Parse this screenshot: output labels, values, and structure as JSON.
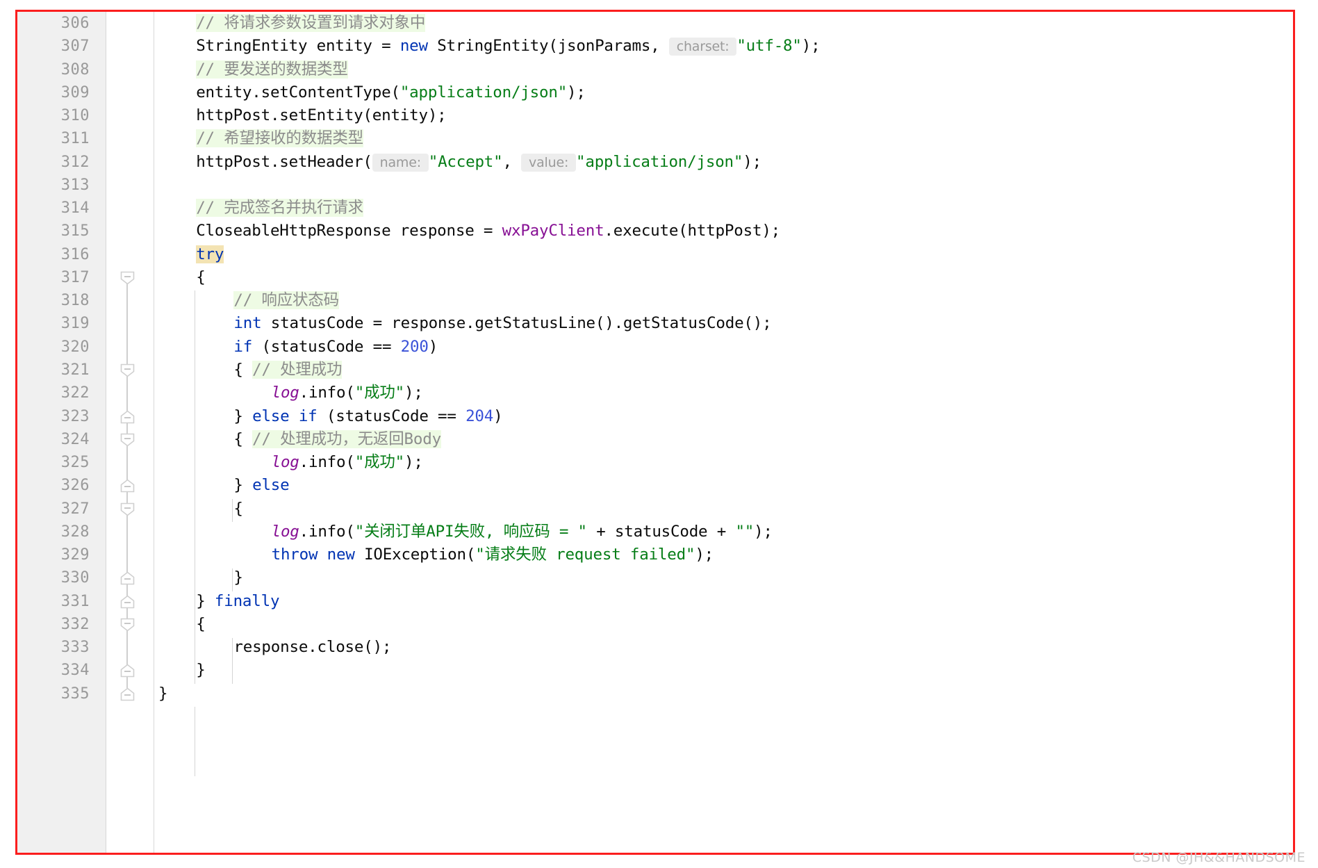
{
  "editor": {
    "language": "Java",
    "theme": "IntelliJ Light",
    "first_line": 306,
    "last_line": 335,
    "colors": {
      "keyword": "#0033b3",
      "number": "#3a52d8",
      "string": "#067d17",
      "field": "#871094",
      "comment_text": "#8c8c8c",
      "comment_background": "#eefbe4",
      "parameter_hint_background": "#ededed",
      "caret_highlight": "#f3e3b3",
      "gutter_background": "#f0f0f0",
      "line_number": "#999999",
      "annotation_border": "#fb1e1e"
    }
  },
  "watermark": {
    "text": "CSDN @JH&&HANDSOME"
  },
  "line_numbers": [
    "306",
    "307",
    "308",
    "309",
    "310",
    "311",
    "312",
    "313",
    "314",
    "315",
    "316",
    "317",
    "318",
    "319",
    "320",
    "321",
    "322",
    "323",
    "324",
    "325",
    "326",
    "327",
    "328",
    "329",
    "330",
    "331",
    "332",
    "333",
    "334",
    "335"
  ],
  "code_lines": [
    {
      "number": "306",
      "text": "    // 将请求参数设置到请求对象中",
      "fold": "none"
    },
    {
      "number": "307",
      "text": "    StringEntity entity = new StringEntity(jsonParams,  charset: \"utf-8\");",
      "fold": "none"
    },
    {
      "number": "308",
      "text": "    // 要发送的数据类型",
      "fold": "none"
    },
    {
      "number": "309",
      "text": "    entity.setContentType(\"application/json\");",
      "fold": "none"
    },
    {
      "number": "310",
      "text": "    httpPost.setEntity(entity);",
      "fold": "none"
    },
    {
      "number": "311",
      "text": "    // 希望接收的数据类型",
      "fold": "none"
    },
    {
      "number": "312",
      "text": "    httpPost.setHeader( name: \"Accept\",  value: \"application/json\");",
      "fold": "none"
    },
    {
      "number": "313",
      "text": "",
      "fold": "none"
    },
    {
      "number": "314",
      "text": "    // 完成签名并执行请求",
      "fold": "none"
    },
    {
      "number": "315",
      "text": "    CloseableHttpResponse response = wxPayClient.execute(httpPost);",
      "fold": "none"
    },
    {
      "number": "316",
      "text": "    try",
      "fold": "none"
    },
    {
      "number": "317",
      "text": "    {",
      "fold": "expanded-down"
    },
    {
      "number": "318",
      "text": "        // 响应状态码",
      "fold": "none"
    },
    {
      "number": "319",
      "text": "        int statusCode = response.getStatusLine().getStatusCode();",
      "fold": "none"
    },
    {
      "number": "320",
      "text": "        if (statusCode == 200)",
      "fold": "none"
    },
    {
      "number": "321",
      "text": "        { // 处理成功",
      "fold": "expanded-down"
    },
    {
      "number": "322",
      "text": "            log.info(\"成功\");",
      "fold": "none"
    },
    {
      "number": "323",
      "text": "        } else if (statusCode == 204)",
      "fold": "expanded-up"
    },
    {
      "number": "324",
      "text": "        { // 处理成功，无返回Body",
      "fold": "expanded-down"
    },
    {
      "number": "325",
      "text": "            log.info(\"成功\");",
      "fold": "none"
    },
    {
      "number": "326",
      "text": "        } else",
      "fold": "expanded-up"
    },
    {
      "number": "327",
      "text": "        {",
      "fold": "expanded-down"
    },
    {
      "number": "328",
      "text": "            log.info(\"关闭订单API失败, 响应码 = \" + statusCode + \"\");",
      "fold": "none"
    },
    {
      "number": "329",
      "text": "            throw new IOException(\"请求失败 request failed\");",
      "fold": "none"
    },
    {
      "number": "330",
      "text": "        }",
      "fold": "expanded-up"
    },
    {
      "number": "331",
      "text": "    } finally",
      "fold": "expanded-up"
    },
    {
      "number": "332",
      "text": "    {",
      "fold": "expanded-down"
    },
    {
      "number": "333",
      "text": "        response.close();",
      "fold": "none"
    },
    {
      "number": "334",
      "text": "    }",
      "fold": "expanded-up"
    },
    {
      "number": "335",
      "text": "}",
      "fold": "expanded-up"
    }
  ],
  "tokens": {
    "l306": [
      {
        "t": "// 将请求参数设置到请求对象中",
        "c": "cmt"
      }
    ],
    "l307": [
      {
        "t": "StringEntity entity = ",
        "c": "plain"
      },
      {
        "t": "new",
        "c": "kw"
      },
      {
        "t": " StringEntity(jsonParams, ",
        "c": "plain"
      },
      {
        "t": " charset: ",
        "c": "hint"
      },
      {
        "t": "\"utf-8\"",
        "c": "str"
      },
      {
        "t": ");",
        "c": "plain"
      }
    ],
    "l308": [
      {
        "t": "// 要发送的数据类型",
        "c": "cmt"
      }
    ],
    "l309": [
      {
        "t": "entity.setContentType(",
        "c": "plain"
      },
      {
        "t": "\"application/json\"",
        "c": "str"
      },
      {
        "t": ");",
        "c": "plain"
      }
    ],
    "l310": [
      {
        "t": "httpPost.setEntity(entity);",
        "c": "plain"
      }
    ],
    "l311": [
      {
        "t": "// 希望接收的数据类型",
        "c": "cmt"
      }
    ],
    "l312": [
      {
        "t": "httpPost.setHeader(",
        "c": "plain"
      },
      {
        "t": " name: ",
        "c": "hint"
      },
      {
        "t": "\"Accept\"",
        "c": "str"
      },
      {
        "t": ", ",
        "c": "plain"
      },
      {
        "t": " value: ",
        "c": "hint"
      },
      {
        "t": "\"application/json\"",
        "c": "str"
      },
      {
        "t": ");",
        "c": "plain"
      }
    ],
    "l313": [],
    "l314": [
      {
        "t": "// 完成签名并执行请求",
        "c": "cmt"
      }
    ],
    "l315": [
      {
        "t": "CloseableHttpResponse response = ",
        "c": "plain"
      },
      {
        "t": "wxPayClient",
        "c": "fld"
      },
      {
        "t": ".execute(httpPost);",
        "c": "plain"
      }
    ],
    "l316": [
      {
        "t": "try",
        "c": "kw caret-hl"
      }
    ],
    "l317": [
      {
        "t": "{",
        "c": "plain"
      }
    ],
    "l318": [
      {
        "t": "// 响应状态码",
        "c": "cmt"
      }
    ],
    "l319": [
      {
        "t": "int",
        "c": "kw"
      },
      {
        "t": " statusCode = response.getStatusLine().getStatusCode();",
        "c": "plain"
      }
    ],
    "l320": [
      {
        "t": "if",
        "c": "kw"
      },
      {
        "t": " (statusCode == ",
        "c": "plain"
      },
      {
        "t": "200",
        "c": "num"
      },
      {
        "t": ")",
        "c": "plain"
      }
    ],
    "l321": [
      {
        "t": "{ ",
        "c": "plain"
      },
      {
        "t": "// 处理成功",
        "c": "cmt"
      }
    ],
    "l322": [
      {
        "t": "log",
        "c": "fld-i"
      },
      {
        "t": ".info(",
        "c": "plain"
      },
      {
        "t": "\"成功\"",
        "c": "str"
      },
      {
        "t": ");",
        "c": "plain"
      }
    ],
    "l323": [
      {
        "t": "} ",
        "c": "plain"
      },
      {
        "t": "else if",
        "c": "kw"
      },
      {
        "t": " (statusCode == ",
        "c": "plain"
      },
      {
        "t": "204",
        "c": "num"
      },
      {
        "t": ")",
        "c": "plain"
      }
    ],
    "l324": [
      {
        "t": "{ ",
        "c": "plain"
      },
      {
        "t": "// 处理成功，无返回Body",
        "c": "cmt"
      }
    ],
    "l325": [
      {
        "t": "log",
        "c": "fld-i"
      },
      {
        "t": ".info(",
        "c": "plain"
      },
      {
        "t": "\"成功\"",
        "c": "str"
      },
      {
        "t": ");",
        "c": "plain"
      }
    ],
    "l326": [
      {
        "t": "} ",
        "c": "plain"
      },
      {
        "t": "else",
        "c": "kw"
      }
    ],
    "l327": [
      {
        "t": "{",
        "c": "plain"
      }
    ],
    "l328": [
      {
        "t": "log",
        "c": "fld-i"
      },
      {
        "t": ".info(",
        "c": "plain"
      },
      {
        "t": "\"关闭订单API失败, 响应码 = \"",
        "c": "str"
      },
      {
        "t": " + statusCode + ",
        "c": "plain"
      },
      {
        "t": "\"\"",
        "c": "str"
      },
      {
        "t": ");",
        "c": "plain"
      }
    ],
    "l329": [
      {
        "t": "throw new",
        "c": "kw"
      },
      {
        "t": " IOException(",
        "c": "plain"
      },
      {
        "t": "\"请求失败 request failed\"",
        "c": "str"
      },
      {
        "t": ");",
        "c": "plain"
      }
    ],
    "l330": [
      {
        "t": "}",
        "c": "plain"
      }
    ],
    "l331": [
      {
        "t": "} ",
        "c": "plain"
      },
      {
        "t": "finally",
        "c": "kw"
      }
    ],
    "l332": [
      {
        "t": "{",
        "c": "plain"
      }
    ],
    "l333": [
      {
        "t": "response.close();",
        "c": "plain"
      }
    ],
    "l334": [
      {
        "t": "}",
        "c": "plain"
      }
    ],
    "l335": [
      {
        "t": "}",
        "c": "plain"
      }
    ]
  }
}
